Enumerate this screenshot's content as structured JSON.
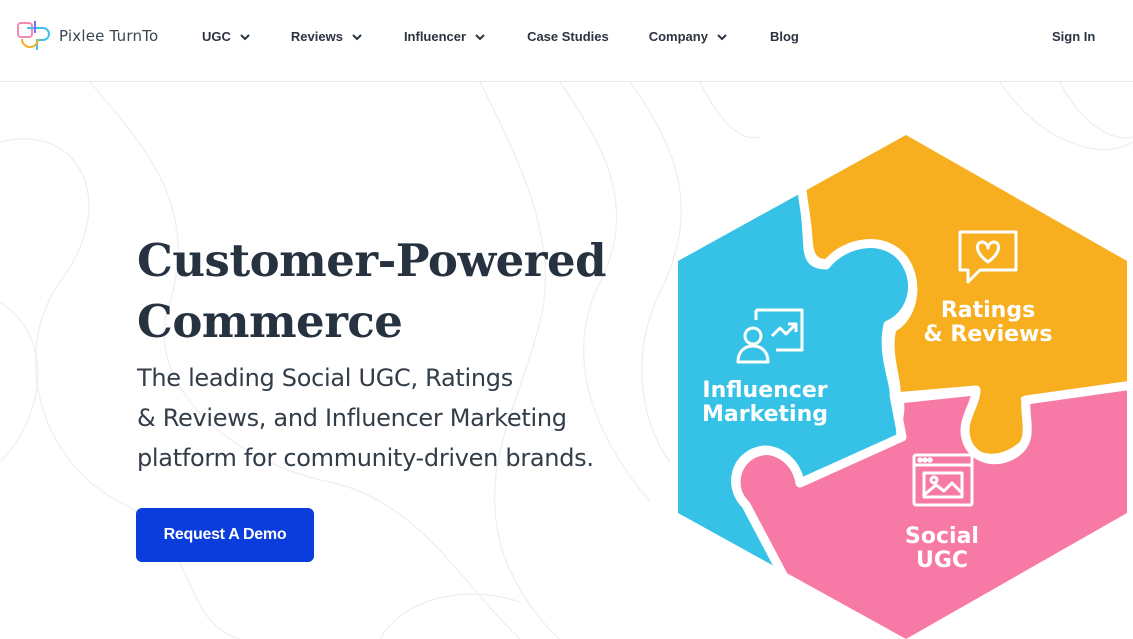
{
  "header": {
    "brand": "Pixlee TurnTo",
    "nav": [
      {
        "label": "UGC",
        "dropdown": true
      },
      {
        "label": "Reviews",
        "dropdown": true
      },
      {
        "label": "Influencer",
        "dropdown": true
      },
      {
        "label": "Case Studies",
        "dropdown": false
      },
      {
        "label": "Company",
        "dropdown": true
      },
      {
        "label": "Blog",
        "dropdown": false
      }
    ],
    "sign_in": "Sign In"
  },
  "hero": {
    "title_line1": "Customer-Powered",
    "title_line2": "Commerce",
    "subtitle_line1": "The leading Social UGC, Ratings",
    "subtitle_line2": "& Reviews, and Influencer Marketing",
    "subtitle_line3": "platform for community-driven brands.",
    "cta": "Request A Demo"
  },
  "puzzle": {
    "pieces": [
      {
        "line1": "Influencer",
        "line2": "Marketing",
        "color": "#35c2e6",
        "icon": "user-share-icon"
      },
      {
        "line1": "Ratings",
        "line2": "& Reviews",
        "color": "#f7ae1f",
        "icon": "heart-chat-icon"
      },
      {
        "line1": "Social",
        "line2": "UGC",
        "color": "#f77aa6",
        "icon": "image-window-icon"
      }
    ]
  },
  "colors": {
    "primary": "#0a3ddc",
    "text": "#26323f",
    "blue_piece": "#35c2e6",
    "orange_piece": "#f7ae1f",
    "pink_piece": "#f77aa6"
  }
}
